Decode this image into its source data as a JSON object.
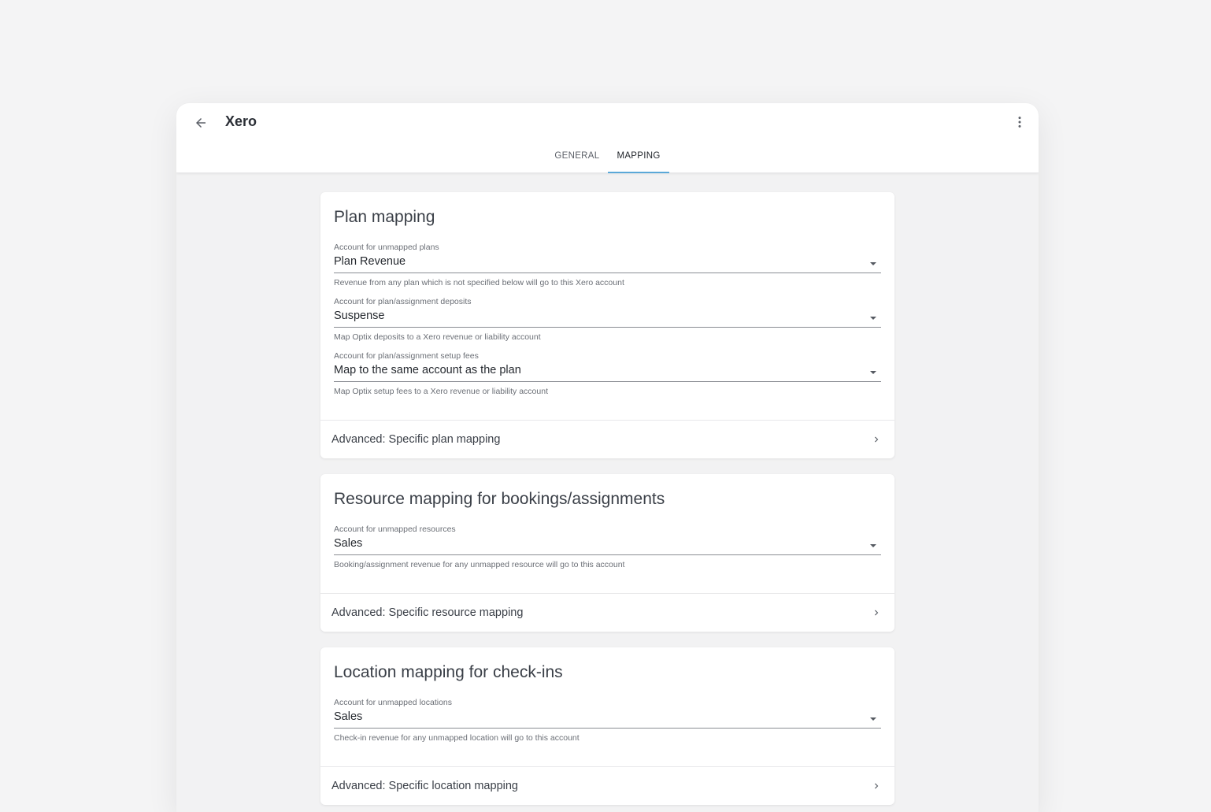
{
  "app": {
    "title": "Xero"
  },
  "tabs": [
    {
      "label": "GENERAL",
      "active": false
    },
    {
      "label": "MAPPING",
      "active": true
    }
  ],
  "colors": {
    "tab_indicator": "#5aa8d8",
    "surface": "#ffffff",
    "background": "#f2f2f3"
  },
  "icons": {
    "back": "arrow-left-icon",
    "more": "more-vert-icon",
    "caret": "caret-down-icon",
    "chevron": "chevron-right-icon"
  },
  "plan": {
    "title": "Plan mapping",
    "unmapped": {
      "label": "Account for unmapped plans",
      "value": "Plan Revenue",
      "helper": "Revenue from any plan which is not specified below will go to this Xero account"
    },
    "deposits": {
      "label": "Account for plan/assignment deposits",
      "value": "Suspense",
      "helper": "Map Optix deposits to a Xero revenue or liability account"
    },
    "setup": {
      "label": "Account for plan/assignment setup fees",
      "value": "Map to the same account as the plan",
      "helper": "Map Optix setup fees to a Xero revenue or liability account"
    },
    "advanced": "Advanced: Specific plan mapping"
  },
  "resource": {
    "title": "Resource mapping for bookings/assignments",
    "unmapped": {
      "label": "Account for unmapped resources",
      "value": "Sales",
      "helper": "Booking/assignment revenue for any unmapped resource will go to this account"
    },
    "advanced": "Advanced: Specific resource mapping"
  },
  "location": {
    "title": "Location mapping for check-ins",
    "unmapped": {
      "label": "Account for unmapped locations",
      "value": "Sales",
      "helper": "Check-in revenue for any unmapped location will go to this account"
    },
    "advanced": "Advanced: Specific location mapping"
  }
}
